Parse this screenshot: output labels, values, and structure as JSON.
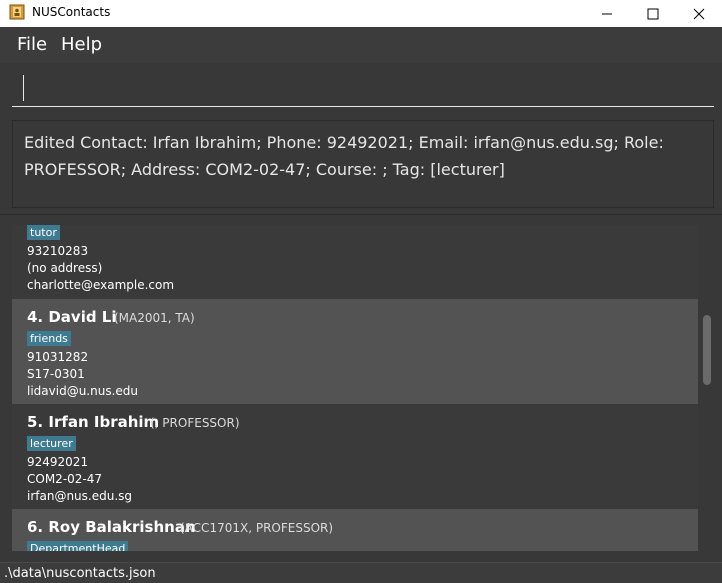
{
  "window": {
    "title": "NUSContacts",
    "app_icon": "address-book-icon",
    "controls": [
      "minimize-icon",
      "maximize-icon",
      "close-icon"
    ]
  },
  "menu": {
    "file": "File",
    "help": "Help"
  },
  "command": {
    "value": ""
  },
  "result": {
    "text": "Edited Contact: Irfan Ibrahim; Phone: 92492021; Email: irfan@nus.edu.sg; Role: PROFESSOR; Address: COM2-02-47; Course: ; Tag: [lecturer]"
  },
  "contacts": [
    {
      "tag": "tutor",
      "phone": "93210283",
      "address": "(no address)",
      "email": "charlotte@example.com"
    },
    {
      "title": "4.  David Li",
      "sub": "(MA2001,  TA)",
      "tag": "friends",
      "phone": "91031282",
      "address": "S17-0301",
      "email": "lidavid@u.nus.edu"
    },
    {
      "title": "5.  Irfan Ibrahim",
      "sub": "(,  PROFESSOR)",
      "tag": "lecturer",
      "phone": "92492021",
      "address": "COM2-02-47",
      "email": "irfan@nus.edu.sg"
    },
    {
      "title": "6.  Roy Balakrishnan",
      "sub": "(ACC1701X,  PROFESSOR)",
      "tag": "DepartmentHead"
    }
  ],
  "status": {
    "path": ".\\data\\nuscontacts.json"
  },
  "colors": {
    "background": "#383838",
    "card_alt": "#535353",
    "tag": "#3e7b91"
  }
}
